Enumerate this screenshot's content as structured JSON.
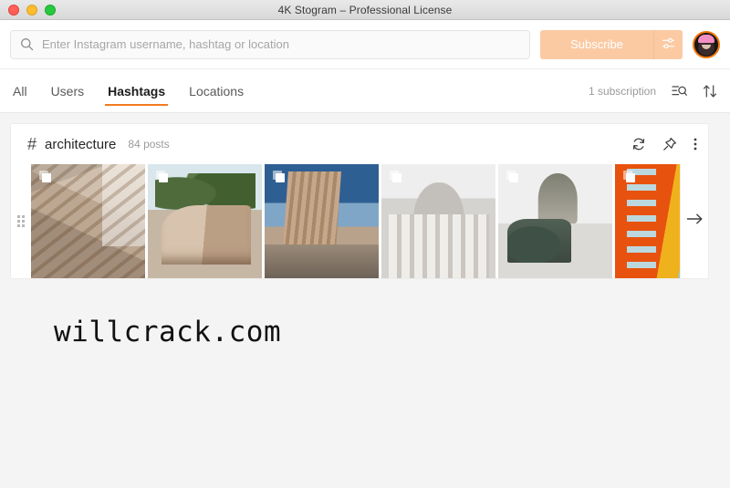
{
  "window": {
    "title": "4K Stogram – Professional License",
    "controls": [
      {
        "name": "close",
        "color": "#ff5f57"
      },
      {
        "name": "minimize",
        "color": "#ffbd2e"
      },
      {
        "name": "maximize",
        "color": "#28c940"
      }
    ]
  },
  "header": {
    "search": {
      "placeholder": "Enter Instagram username, hashtag or location",
      "value": "",
      "icon": "search-icon"
    },
    "subscribe_label": "Subscribe",
    "settings_icon": "sliders-icon",
    "avatar_icon": "user-avatar"
  },
  "tabbar": {
    "tabs": [
      {
        "label": "All",
        "active": false
      },
      {
        "label": "Users",
        "active": false
      },
      {
        "label": "Hashtags",
        "active": true
      },
      {
        "label": "Locations",
        "active": false
      }
    ],
    "subscription_count": "1 subscription",
    "filter_icon": "filter-search-icon",
    "sort_icon": "sort-icon",
    "active_accent": "#f47920"
  },
  "card": {
    "hash_symbol": "#",
    "hashtag": "architecture",
    "post_count": "84 posts",
    "actions": [
      {
        "name": "refresh-icon"
      },
      {
        "name": "pin-icon"
      },
      {
        "name": "more-options-icon"
      }
    ],
    "drag_handle_icon": "drag-handle-icon",
    "next_icon": "arrow-right-icon",
    "thumbnails": [
      {
        "alt": "terraced green building rendering",
        "multi": true
      },
      {
        "alt": "curved timber pavilion rendering",
        "multi": true
      },
      {
        "alt": "blue tower rendering",
        "multi": true
      },
      {
        "alt": "neoclassical columned facade",
        "multi": true
      },
      {
        "alt": "domed cathedral with equestrian statue",
        "multi": true
      },
      {
        "alt": "orange shuttered building facade",
        "multi": true
      }
    ]
  },
  "watermark": {
    "text": "willcrack.com"
  },
  "colors": {
    "accent": "#f47920",
    "subscribe_bg": "#fbcaa3",
    "page_bg": "#f4f4f4"
  }
}
